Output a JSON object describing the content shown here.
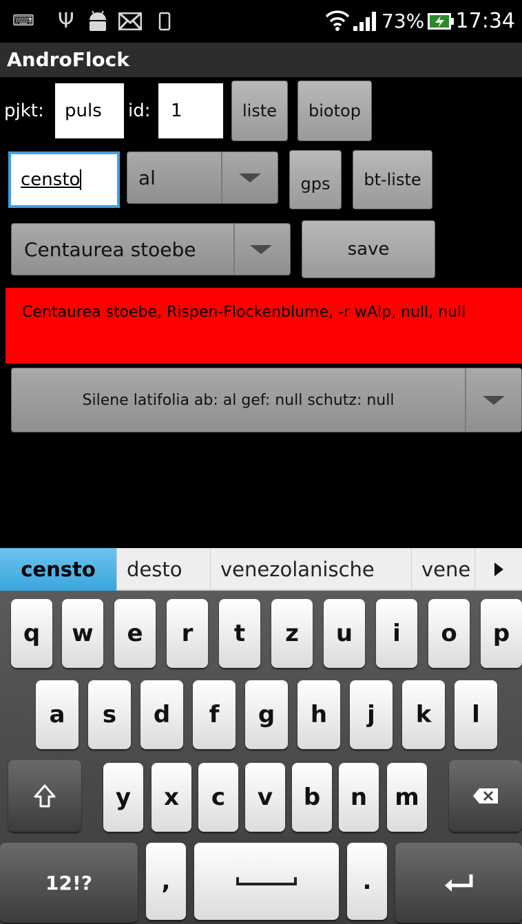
{
  "statusbar": {
    "icons": [
      "keyboard-icon",
      "usb-icon",
      "android-icon",
      "mail-icon",
      "phone-icon",
      "wifi-icon",
      "signal-icon",
      "battery-icon"
    ],
    "battery_percent": "73%",
    "time": "17:34"
  },
  "app": {
    "title": "AndroFlock"
  },
  "row1": {
    "pjkt_label": "pjkt:",
    "pjkt_value": "puls",
    "id_label": "id:",
    "id_value": "1",
    "liste_button": "liste",
    "biotop_button": "biotop"
  },
  "row2": {
    "search_value": "censto",
    "filter_spinner_value": "al",
    "gps_button": "gps",
    "btliste_button": "bt-liste"
  },
  "row3": {
    "species_spinner_value": "Centaurea stoebe",
    "save_button": "save"
  },
  "info_text": "Centaurea stoebe, Rispen-Flockenblume, -r wAlp, null, null",
  "record_spinner_value": "Silene latifolia ab: al gef: null schutz: null",
  "suggestions": [
    "censto",
    "desto",
    "venezolanische",
    "vene"
  ],
  "keyboard": {
    "row1": [
      "q",
      "w",
      "e",
      "r",
      "t",
      "z",
      "u",
      "i",
      "o",
      "p"
    ],
    "row2": [
      "a",
      "s",
      "d",
      "f",
      "g",
      "h",
      "j",
      "k",
      "l"
    ],
    "row3": [
      "y",
      "x",
      "c",
      "v",
      "b",
      "n",
      "m"
    ],
    "symbols_key": "12!?",
    "comma_key": ",",
    "period_key": "."
  }
}
